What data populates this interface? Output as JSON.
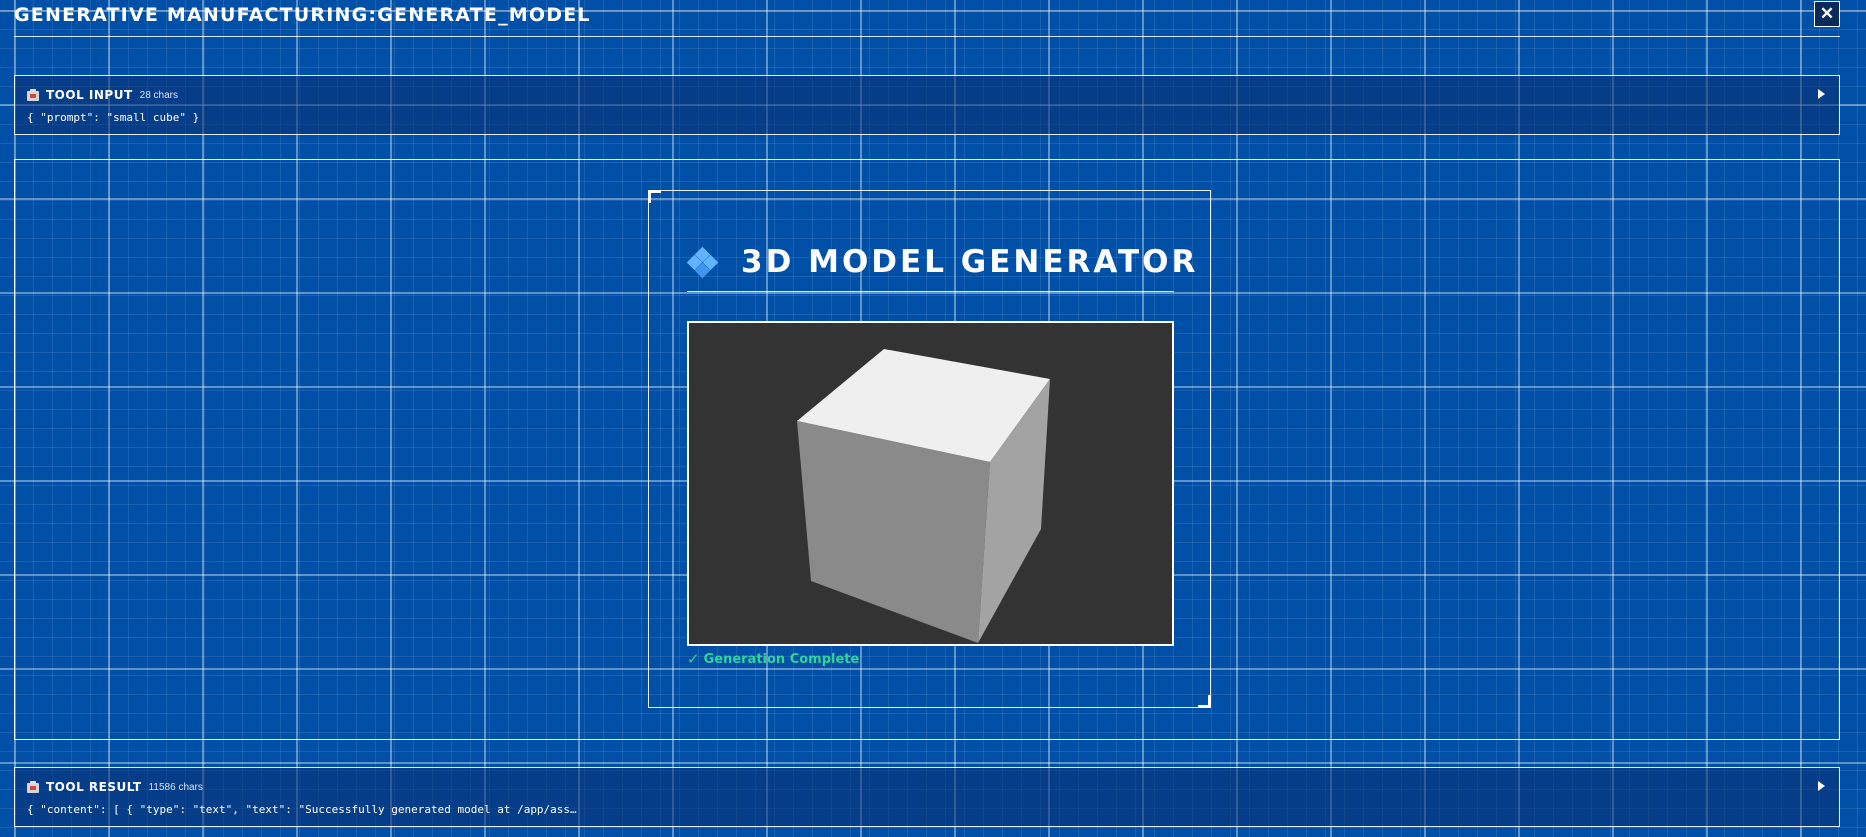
{
  "header": {
    "title": "GENERATIVE MANUFACTURING:GENERATE_MODEL",
    "close_label": "✕"
  },
  "tool_input": {
    "label": "TOOL INPUT",
    "char_count": "28 chars",
    "content": "{ \"prompt\": \"small cube\" }",
    "icon": "clipboard-icon"
  },
  "generator": {
    "icon": "diamond-cluster-icon",
    "title": "3D MODEL GENERATOR",
    "status_icon": "✓",
    "status_text": "Generation Complete",
    "viewport_background": "#333333",
    "model_face_colors": {
      "top": "#efefef",
      "left": "#8a8a8a",
      "right": "#a3a3a3"
    }
  },
  "tool_result": {
    "label": "TOOL RESULT",
    "char_count": "11586 chars",
    "content": "{ \"content\": [ { \"type\": \"text\", \"text\": \"Successfully generated model at /app/ass…",
    "icon": "clipboard-icon"
  },
  "colors": {
    "background": "#0050a8",
    "accent_green": "#34d399",
    "accent_blue": "#5fb3ff"
  }
}
